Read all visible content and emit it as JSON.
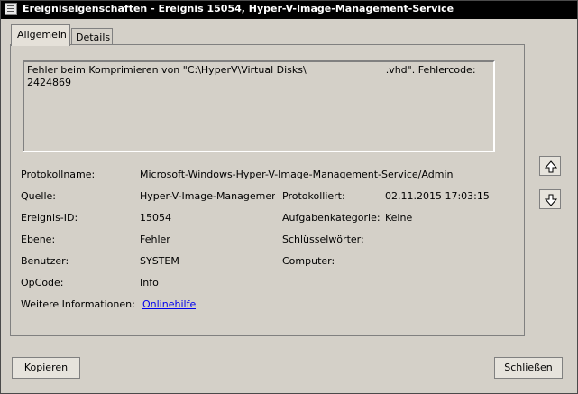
{
  "window": {
    "title": "Ereigniseigenschaften - Ereignis 15054, Hyper-V-Image-Management-Service"
  },
  "tabs": [
    {
      "label": "Allgemein"
    },
    {
      "label": "Details"
    }
  ],
  "message": {
    "line1_prefix": "Fehler beim Komprimieren von \"C:\\HyperV\\Virtual Disks\\",
    "line1_suffix": ".vhd\". Fehlercode:",
    "line2": "2424869"
  },
  "fields": {
    "protokollname_label": "Protokollname:",
    "protokollname_value": "Microsoft-Windows-Hyper-V-Image-Management-Service/Admin",
    "quelle_label": "Quelle:",
    "quelle_value": "Hyper-V-Image-Managemer",
    "protokolliert_label": "Protokolliert:",
    "protokolliert_value": "02.11.2015 17:03:15",
    "ereignis_id_label": "Ereignis-ID:",
    "ereignis_id_value": "15054",
    "aufgabenkategorie_label": "Aufgabenkategorie:",
    "aufgabenkategorie_value": "Keine",
    "ebene_label": "Ebene:",
    "ebene_value": "Fehler",
    "schluesselwoerter_label": "Schlüsselwörter:",
    "schluesselwoerter_value": "",
    "benutzer_label": "Benutzer:",
    "benutzer_value": "SYSTEM",
    "computer_label": "Computer:",
    "computer_value": "",
    "opcode_label": "OpCode:",
    "opcode_value": "Info",
    "weitere_label": "Weitere Informationen:",
    "weitere_link": "Onlinehilfe"
  },
  "buttons": {
    "copy": "Kopieren",
    "close": "Schließen"
  },
  "icons": {
    "up": "arrow-up-icon",
    "down": "arrow-down-icon"
  }
}
